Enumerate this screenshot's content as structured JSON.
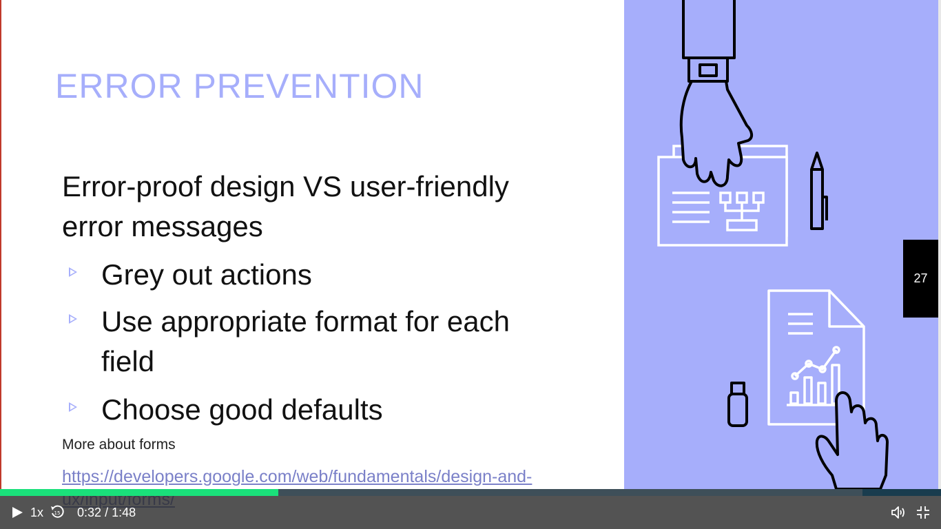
{
  "slide": {
    "title": "ERROR PREVENTION",
    "intro": "Error-proof design VS user-friendly error messages",
    "bullets": [
      "Grey out actions",
      "Use appropriate format for each field",
      "Choose good defaults"
    ],
    "more_label": "More about forms",
    "link_text": "https://developers.google.com/web/fundamentals/design-and-ux/input/forms/",
    "page_number": "27",
    "colors": {
      "accent": "#a6aefb",
      "text": "#111111",
      "link": "#7a80c8"
    },
    "illustration": "hands-documents-chart-illustration"
  },
  "player": {
    "speed": "1x",
    "current_time": "0:32",
    "separator": "/",
    "duration": "1:48",
    "progress_fraction": 0.296,
    "buffered_fraction": 1.0,
    "colors": {
      "progress": "#1ae07a",
      "bar_bg": "#3e4f59"
    },
    "icons": [
      "play-icon",
      "rewind-15-icon",
      "volume-icon",
      "exit-fullscreen-icon"
    ]
  }
}
